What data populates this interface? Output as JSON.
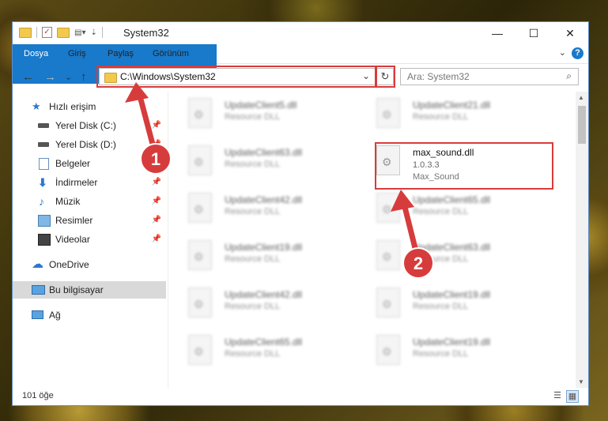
{
  "window": {
    "title": "System32"
  },
  "controls": {
    "minimize": "—",
    "maximize": "☐",
    "close": "✕"
  },
  "ribbon": {
    "tabs": [
      "Dosya",
      "Giriş",
      "Paylaş",
      "Görünüm"
    ],
    "help": "?"
  },
  "nav": {
    "back": "←",
    "forward": "→",
    "recent": "⌄",
    "up": "↑"
  },
  "address": {
    "path": "C:\\Windows\\System32",
    "refresh_icon": "↻"
  },
  "search": {
    "placeholder": "Ara: System32",
    "icon": "search-icon"
  },
  "sidebar": {
    "items": [
      {
        "label": "Hızlı erişim",
        "icon": "star-icon",
        "pinned": false
      },
      {
        "label": "Yerel Disk (C:)",
        "icon": "drive-icon",
        "pinned": true
      },
      {
        "label": "Yerel Disk (D:)",
        "icon": "drive-icon",
        "pinned": true
      },
      {
        "label": "Belgeler",
        "icon": "document-icon",
        "pinned": true
      },
      {
        "label": "İndirmeler",
        "icon": "download-icon",
        "pinned": true
      },
      {
        "label": "Müzik",
        "icon": "music-icon",
        "pinned": true
      },
      {
        "label": "Resimler",
        "icon": "picture-icon",
        "pinned": true
      },
      {
        "label": "Videolar",
        "icon": "video-icon",
        "pinned": true
      },
      {
        "label": "OneDrive",
        "icon": "cloud-icon",
        "pinned": false
      },
      {
        "label": "Bu bilgisayar",
        "icon": "computer-icon",
        "pinned": false,
        "selected": true
      },
      {
        "label": "Ağ",
        "icon": "network-icon",
        "pinned": false
      }
    ]
  },
  "files": {
    "left": [
      {
        "name": "UpdateClient5.dll",
        "desc": "Resource DLL"
      },
      {
        "name": "UpdateClient63.dll",
        "desc": "Resource DLL"
      },
      {
        "name": "UpdateClient42.dll",
        "desc": "Resource DLL"
      },
      {
        "name": "UpdateClient19.dll",
        "desc": "Resource DLL"
      },
      {
        "name": "UpdateClient42.dll",
        "desc": "Resource DLL"
      },
      {
        "name": "UpdateClient65.dll",
        "desc": "Resource DLL"
      }
    ],
    "right": [
      {
        "name": "UpdateClient21.dll",
        "desc": "Resource DLL"
      },
      {
        "name": "UpdateClient65.dll",
        "desc": "Resource DLL"
      },
      {
        "name": "UpdateClient63.dll",
        "desc": "Resource DLL"
      },
      {
        "name": "UpdateClient19.dll",
        "desc": "Resource DLL"
      },
      {
        "name": "UpdateClient19.dll",
        "desc": "Resource DLL"
      }
    ],
    "target": {
      "name": "max_sound.dll",
      "version": "1.0.3.3",
      "desc": "Max_Sound"
    }
  },
  "status": {
    "count": "101 öğe"
  },
  "annotations": {
    "step1": "1",
    "step2": "2",
    "color": "#d73c3c"
  }
}
